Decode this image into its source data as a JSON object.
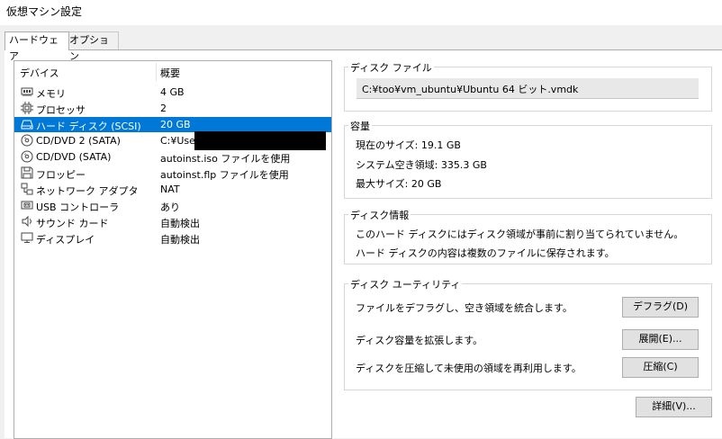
{
  "window": {
    "title": "仮想マシン設定"
  },
  "tabs": [
    {
      "label": "ハードウェア",
      "active": true
    },
    {
      "label": "オプション",
      "active": false
    }
  ],
  "device_list": {
    "headers": {
      "device": "デバイス",
      "summary": "概要"
    },
    "rows": [
      {
        "name": "メモリ",
        "summary": "4 GB",
        "icon": "memory-icon"
      },
      {
        "name": "プロセッサ",
        "summary": "2",
        "icon": "processor-icon"
      },
      {
        "name": "ハード ディスク (SCSI)",
        "summary": "20 GB",
        "icon": "hard-disk-icon",
        "selected": true
      },
      {
        "name": "CD/DVD 2 (SATA)",
        "summary": "C:¥Use",
        "icon": "cd-dvd-icon",
        "redacted": true
      },
      {
        "name": "CD/DVD (SATA)",
        "summary": "autoinst.iso ファイルを使用",
        "icon": "cd-dvd-icon"
      },
      {
        "name": "フロッピー",
        "summary": "autoinst.flp ファイルを使用",
        "icon": "floppy-icon"
      },
      {
        "name": "ネットワーク アダプタ",
        "summary": "NAT",
        "icon": "network-icon"
      },
      {
        "name": "USB コントローラ",
        "summary": "あり",
        "icon": "usb-icon"
      },
      {
        "name": "サウンド カード",
        "summary": "自動検出",
        "icon": "sound-icon"
      },
      {
        "name": "ディスプレイ",
        "summary": "自動検出",
        "icon": "display-icon"
      }
    ]
  },
  "disk_file": {
    "label": "ディスク ファイル",
    "path": "C:¥too¥vm_ubuntu¥Ubuntu 64 ビット.vmdk"
  },
  "capacity": {
    "label": "容量",
    "current_size": "現在のサイズ: 19.1 GB",
    "system_free": "システム空き領域: 335.3 GB",
    "max_size": "最大サイズ: 20 GB"
  },
  "disk_info": {
    "label": "ディスク情報",
    "line1": "このハード ディスクにはディスク領域が事前に割り当てられていません。",
    "line2": "ハード ディスクの内容は複数のファイルに保存されます。"
  },
  "disk_utility": {
    "label": "ディスク ユーティリティ",
    "defrag_text": "ファイルをデフラグし、空き領域を統合します。",
    "defrag_button": "デフラグ(D)",
    "expand_text": "ディスク容量を拡張します。",
    "expand_button": "展開(E)...",
    "compact_text": "ディスクを圧縮して未使用の領域を再利用します。",
    "compact_button": "圧縮(C)"
  },
  "advanced_button": "詳細(V)..."
}
